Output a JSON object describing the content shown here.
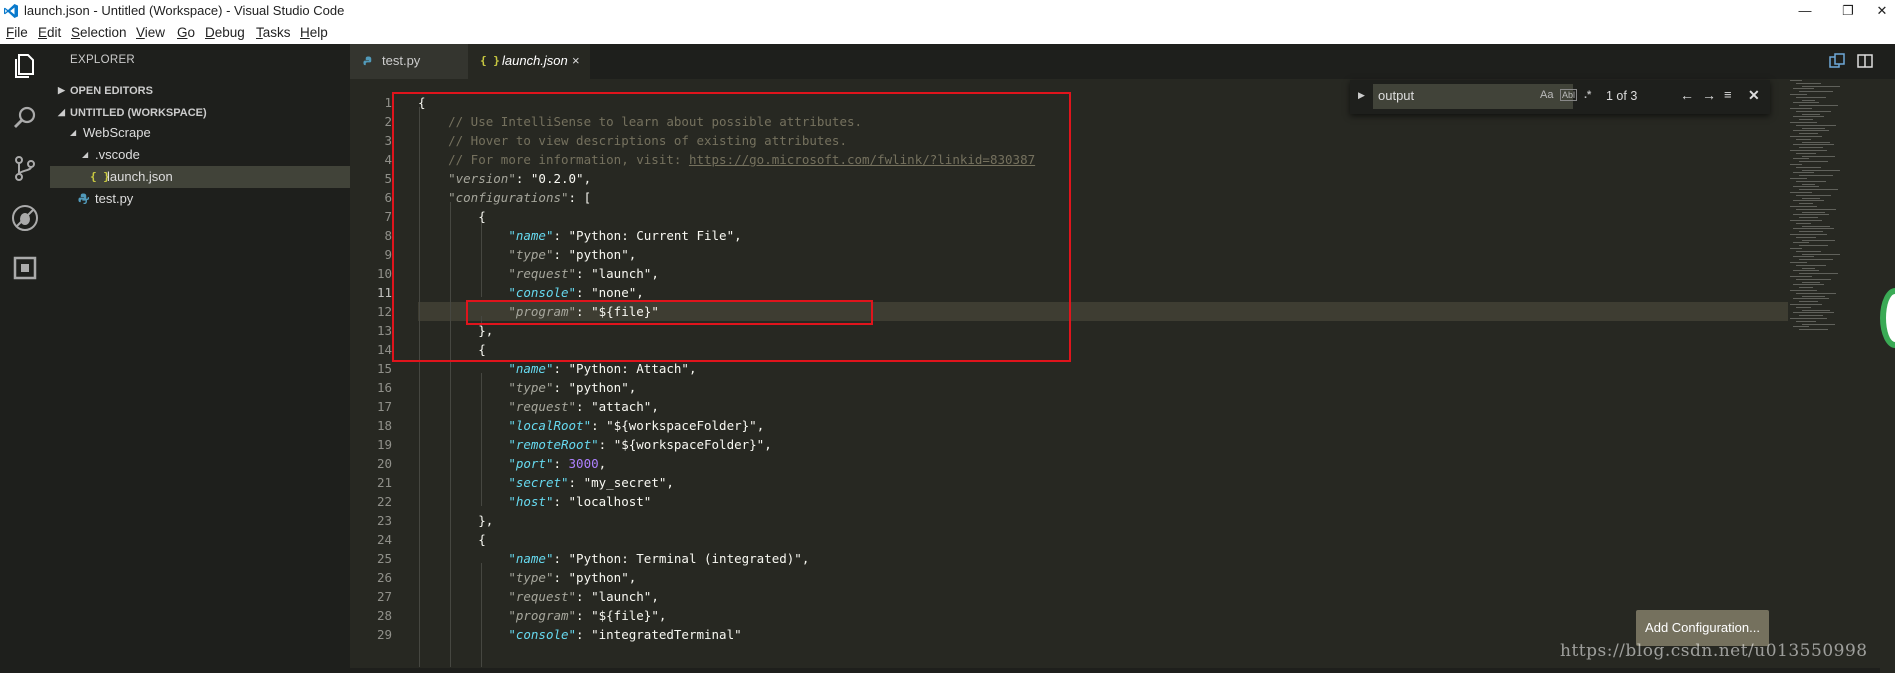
{
  "window": {
    "title": "launch.json - Untitled (Workspace) - Visual Studio Code",
    "controls": [
      "minimize",
      "restore",
      "close"
    ]
  },
  "menu": [
    "File",
    "Edit",
    "Selection",
    "View",
    "Go",
    "Debug",
    "Tasks",
    "Help"
  ],
  "menu_mnemonics": [
    "F",
    "E",
    "S",
    "V",
    "G",
    "D",
    "T",
    "H"
  ],
  "activity_bar": [
    "files-icon",
    "search-icon",
    "source-control-icon",
    "debug-icon",
    "extensions-icon"
  ],
  "sidebar": {
    "header": "EXPLORER",
    "open_editors": "OPEN EDITORS",
    "workspace": "UNTITLED (WORKSPACE)",
    "tree": [
      {
        "label": "WebScrape",
        "type": "folder",
        "expanded": true
      },
      {
        "label": ".vscode",
        "type": "folder",
        "expanded": true
      },
      {
        "label": "launch.json",
        "type": "json",
        "selected": true
      },
      {
        "label": "test.py",
        "type": "python"
      }
    ]
  },
  "tabs": [
    {
      "label": "test.py",
      "icon": "python-icon",
      "active": false
    },
    {
      "label": "launch.json",
      "icon": "json-icon",
      "active": true,
      "close": "×"
    }
  ],
  "icons": {
    "json": "{ }",
    "python_color": "#519aba",
    "json_color": "#cbcb41"
  },
  "find_widget": {
    "query": "output",
    "options": [
      "Aa",
      "Abl",
      ".*"
    ],
    "count": "1 of 3",
    "buttons": [
      "previous-match",
      "next-match",
      "find-in-selection",
      "close"
    ]
  },
  "editor": {
    "current_line": 11,
    "line_numbers": [
      "1",
      "2",
      "3",
      "4",
      "5",
      "6",
      "7",
      "8",
      "9",
      "10",
      "11",
      "12",
      "13",
      "14",
      "15",
      "16",
      "17",
      "18",
      "19",
      "20",
      "21",
      "22",
      "23",
      "24",
      "25",
      "26",
      "27",
      "28",
      "29"
    ],
    "lines": [
      "{",
      "    // Use IntelliSense to learn about possible attributes.",
      "    // Hover to view descriptions of existing attributes.",
      "    // For more information, visit: https://go.microsoft.com/fwlink/?linkid=830387",
      "    \"version\": \"0.2.0\",",
      "    \"configurations\": [",
      "        {",
      "            \"name\": \"Python: Current File\",",
      "            \"type\": \"python\",",
      "            \"request\": \"launch\",",
      "            \"console\": \"none\",",
      "            \"program\": \"${file}\"",
      "        },",
      "        {",
      "            \"name\": \"Python: Attach\",",
      "            \"type\": \"python\",",
      "            \"request\": \"attach\",",
      "            \"localRoot\": \"${workspaceFolder}\",",
      "            \"remoteRoot\": \"${workspaceFolder}\",",
      "            \"port\": 3000,",
      "            \"secret\": \"my_secret\",",
      "            \"host\": \"localhost\"",
      "        },",
      "        {",
      "            \"name\": \"Python: Terminal (integrated)\",",
      "            \"type\": \"python\",",
      "            \"request\": \"launch\",",
      "            \"program\": \"${file}\",",
      "            \"console\": \"integratedTerminal\""
    ]
  },
  "notification": {
    "button": "Add Configuration..."
  },
  "watermark": "https://blog.csdn.net/u013550998",
  "colors": {
    "annotation_red": "#e0141c",
    "editor_bg": "#272822",
    "sidebar_bg": "#1e1f1c"
  }
}
